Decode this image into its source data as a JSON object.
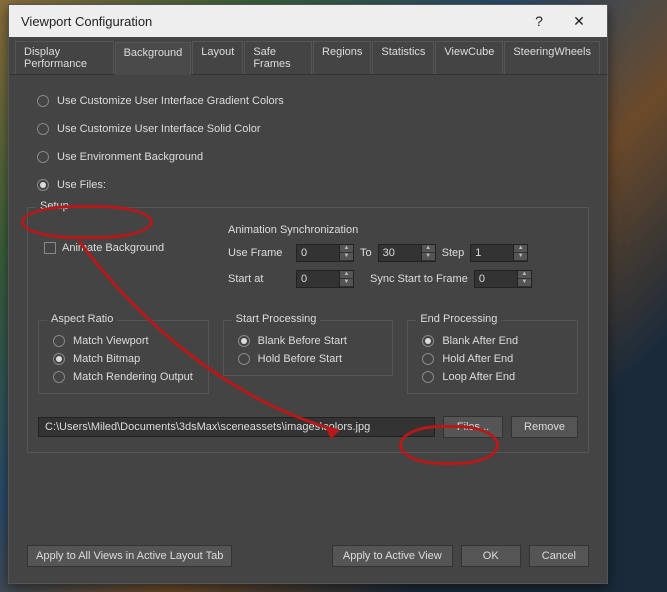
{
  "dialog": {
    "title": "Viewport Configuration",
    "help": "?",
    "close": "✕"
  },
  "tabs": [
    {
      "label": "Display Performance",
      "active": false
    },
    {
      "label": "Background",
      "active": true
    },
    {
      "label": "Layout",
      "active": false
    },
    {
      "label": "Safe Frames",
      "active": false
    },
    {
      "label": "Regions",
      "active": false
    },
    {
      "label": "Statistics",
      "active": false
    },
    {
      "label": "ViewCube",
      "active": false
    },
    {
      "label": "SteeringWheels",
      "active": false
    }
  ],
  "bg_options": {
    "gradient": "Use Customize User Interface Gradient Colors",
    "solid": "Use Customize User Interface Solid Color",
    "env": "Use Environment Background",
    "files": "Use Files:",
    "selected": "files"
  },
  "setup": {
    "legend": "Setup",
    "animate_bg": "Animate Background",
    "sync": {
      "title": "Animation Synchronization",
      "use_frame_label": "Use Frame",
      "use_frame_value": "0",
      "to_label": "To",
      "to_value": "30",
      "step_label": "Step",
      "step_value": "1",
      "start_at_label": "Start at",
      "start_at_value": "0",
      "sync_start_label": "Sync Start to Frame",
      "sync_start_value": "0"
    },
    "aspect": {
      "legend": "Aspect Ratio",
      "opts": {
        "viewport": "Match Viewport",
        "bitmap": "Match Bitmap",
        "render": "Match Rendering Output"
      },
      "selected": "bitmap"
    },
    "start_proc": {
      "legend": "Start Processing",
      "opts": {
        "blank": "Blank Before Start",
        "hold": "Hold Before Start"
      },
      "selected": "blank"
    },
    "end_proc": {
      "legend": "End Processing",
      "opts": {
        "blank": "Blank After End",
        "hold": "Hold After End",
        "loop": "Loop After End"
      },
      "selected": "blank"
    },
    "file_path": "C:\\Users\\Miled\\Documents\\3dsMax\\sceneassets\\images\\colors.jpg",
    "files_btn": "Files...",
    "remove_btn": "Remove"
  },
  "buttons": {
    "apply_all": "Apply to All Views in Active Layout Tab",
    "apply_active": "Apply to Active View",
    "ok": "OK",
    "cancel": "Cancel"
  }
}
